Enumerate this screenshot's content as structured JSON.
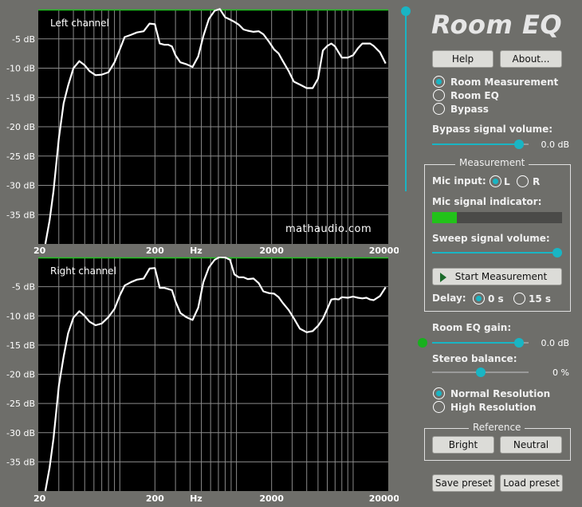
{
  "app": {
    "title": "Room EQ"
  },
  "colors": {
    "accent": "#19b5c4",
    "plot_bg": "#000000",
    "grid": "#8a8a8a",
    "topline": "#1fbf1f",
    "curve": "#ffffff",
    "meter": "#22c21a"
  },
  "buttons": {
    "help": "Help",
    "about": "About...",
    "start_measurement": "Start Measurement",
    "bright": "Bright",
    "neutral": "Neutral",
    "save_preset": "Save preset",
    "load_preset": "Load preset"
  },
  "mode": {
    "options": [
      "Room Measurement",
      "Room EQ",
      "Bypass"
    ],
    "selected": 0
  },
  "bypass_volume": {
    "label": "Bypass signal volume:",
    "value_text": "0.0 dB",
    "level": 0.9
  },
  "measurement": {
    "title": "Measurement",
    "mic_input_label": "Mic input:",
    "mic_options": [
      "L",
      "R"
    ],
    "mic_selected": 0,
    "mic_indicator_label": "Mic signal indicator:",
    "mic_level": 0.19,
    "sweep_label": "Sweep signal volume:",
    "sweep_level": 1.0,
    "delay_label": "Delay:",
    "delay_options": [
      "0 s",
      "15 s"
    ],
    "delay_selected": 0
  },
  "room_eq_gain": {
    "label": "Room EQ gain:",
    "value_text": "0.0 dB",
    "level": 0.9
  },
  "stereo_balance": {
    "label": "Stereo balance:",
    "value_text": "0 %",
    "level": 0.5
  },
  "resolution": {
    "options": [
      "Normal Resolution",
      "High Resolution"
    ],
    "selected": 0
  },
  "reference": {
    "title": "Reference"
  },
  "watermark": "mathaudio.com",
  "top_slider_level": 1.0,
  "chart_data": [
    {
      "type": "line",
      "title": "Left channel",
      "xlabel": "Hz",
      "x_scale": "log",
      "xlim": [
        20,
        20000
      ],
      "ylim": [
        -40,
        0
      ],
      "x_ticks": [
        "20",
        "200",
        "2000",
        "20000"
      ],
      "x_tick_values": [
        20,
        200,
        2000,
        20000
      ],
      "y_ticks": [
        "-5 dB",
        "-10 dB",
        "-15 dB",
        "-20 dB",
        "-25 dB",
        "-30 dB",
        "-35 dB"
      ],
      "y_tick_values": [
        -5,
        -10,
        -15,
        -20,
        -25,
        -30,
        -35
      ],
      "grid": true,
      "series": [
        {
          "x": [
            23,
            25,
            27,
            30,
            33,
            36,
            40,
            45,
            50,
            55,
            62,
            70,
            80,
            90,
            100,
            110,
            125,
            140,
            160,
            180,
            200,
            220,
            240,
            260,
            280,
            300,
            330,
            370,
            420,
            470,
            520,
            580,
            650,
            720,
            800,
            880,
            960,
            1050,
            1150,
            1250,
            1400,
            1550,
            1700,
            1900,
            2100,
            2300,
            2500,
            2800,
            3100,
            3500,
            4000,
            4500,
            5000,
            5500,
            6000,
            6500,
            7000,
            7500,
            8000,
            9000,
            10000,
            11000,
            12000,
            13000,
            14000,
            15000,
            17000,
            19000
          ],
          "y": [
            -40,
            -36,
            -31,
            -22,
            -16,
            -13,
            -10,
            -8.8,
            -9.5,
            -10.5,
            -11.2,
            -11.1,
            -10.7,
            -9,
            -6.8,
            -4.7,
            -4.3,
            -3.9,
            -3.7,
            -2.4,
            -2.5,
            -5.8,
            -6,
            -6,
            -6.3,
            -7.8,
            -9,
            -9.3,
            -9.8,
            -8,
            -4.5,
            -1.6,
            -0.2,
            0.1,
            -1.3,
            -1.7,
            -2.1,
            -2.6,
            -3.4,
            -3.6,
            -3.8,
            -3.7,
            -4.2,
            -5.5,
            -6.8,
            -7.5,
            -8.8,
            -10.5,
            -12.3,
            -12.8,
            -13.4,
            -13.4,
            -11.8,
            -7,
            -6.2,
            -5.8,
            -6.3,
            -7.3,
            -8.2,
            -8.2,
            -7.8,
            -6.6,
            -5.8,
            -5.8,
            -5.8,
            -6.2,
            -7.3,
            -9.2
          ]
        }
      ]
    },
    {
      "type": "line",
      "title": "Right channel",
      "xlabel": "Hz",
      "x_scale": "log",
      "xlim": [
        20,
        20000
      ],
      "ylim": [
        -40,
        0
      ],
      "x_ticks": [
        "20",
        "200",
        "2000",
        "20000"
      ],
      "x_tick_values": [
        20,
        200,
        2000,
        20000
      ],
      "y_ticks": [
        "-5 dB",
        "-10 dB",
        "-15 dB",
        "-20 dB",
        "-25 dB",
        "-30 dB",
        "-35 dB"
      ],
      "y_tick_values": [
        -5,
        -10,
        -15,
        -20,
        -25,
        -30,
        -35
      ],
      "grid": true,
      "series": [
        {
          "x": [
            23,
            25,
            27,
            30,
            33,
            36,
            40,
            45,
            50,
            55,
            62,
            70,
            80,
            90,
            100,
            110,
            125,
            140,
            160,
            180,
            200,
            220,
            240,
            260,
            280,
            300,
            330,
            370,
            420,
            470,
            520,
            580,
            650,
            720,
            800,
            880,
            960,
            1050,
            1150,
            1250,
            1400,
            1550,
            1700,
            1900,
            2100,
            2300,
            2500,
            2800,
            3100,
            3500,
            4000,
            4500,
            5000,
            5500,
            6000,
            6500,
            7000,
            7500,
            8000,
            9000,
            10000,
            11000,
            12000,
            13000,
            14000,
            15000,
            17000,
            19000
          ],
          "y": [
            -40,
            -36,
            -31,
            -22,
            -17,
            -13,
            -10.3,
            -9.2,
            -10,
            -11,
            -11.6,
            -11.3,
            -10.2,
            -8.8,
            -6.5,
            -4.8,
            -4.2,
            -3.8,
            -3.6,
            -1.9,
            -1.8,
            -5.2,
            -5.2,
            -5.4,
            -5.6,
            -7.5,
            -9.5,
            -10.2,
            -10.7,
            -8.6,
            -4.2,
            -1.7,
            -0.4,
            0.1,
            0,
            -0.4,
            -2.9,
            -3.4,
            -3.4,
            -3.7,
            -3.6,
            -4.4,
            -5.8,
            -6.1,
            -6.2,
            -6.8,
            -7.8,
            -9,
            -10.4,
            -12.2,
            -12.8,
            -12.6,
            -11.7,
            -10.5,
            -8.8,
            -7.2,
            -7.1,
            -7.2,
            -6.8,
            -6.9,
            -6.7,
            -6.9,
            -7,
            -6.9,
            -7.2,
            -7.3,
            -6.6,
            -5.1
          ]
        }
      ]
    }
  ]
}
